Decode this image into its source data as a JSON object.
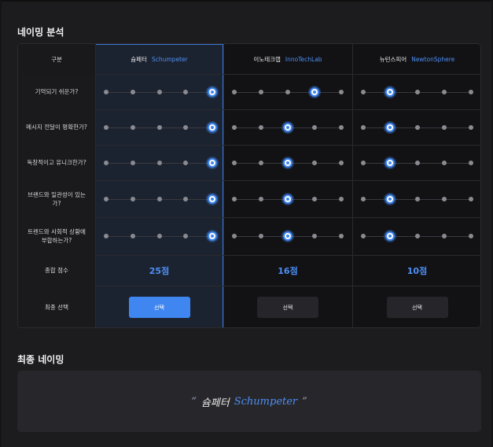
{
  "sections": {
    "analysis_title": "네이밍 분석",
    "final_title": "최종 네이밍"
  },
  "table": {
    "header_label": "구분",
    "candidates": [
      {
        "ko": "슘페터",
        "en": "Schumpeter",
        "score": "25점",
        "select_label": "선택",
        "selected": true
      },
      {
        "ko": "이노테크랩",
        "en": "InnoTechLab",
        "score": "16점",
        "select_label": "선택",
        "selected": false
      },
      {
        "ko": "뉴턴스피어",
        "en": "NewtonSphere",
        "score": "10점",
        "select_label": "선택",
        "selected": false
      }
    ],
    "criteria": [
      {
        "label": "기억되기 쉬운가?",
        "ratings": [
          5,
          4,
          2
        ]
      },
      {
        "label": "메시지 전달이 명확한가?",
        "ratings": [
          5,
          3,
          2
        ]
      },
      {
        "label": "독창적이고 유니크한가?",
        "ratings": [
          5,
          3,
          2
        ]
      },
      {
        "label": "브랜드와 일관성이 있는가?",
        "ratings": [
          5,
          3,
          2
        ]
      },
      {
        "label": "트렌드와 사회적 상황에 부합하는가?",
        "ratings": [
          5,
          3,
          2
        ]
      }
    ],
    "score_label": "종합 점수",
    "final_label": "최종 선택",
    "scale_max": 5
  },
  "final_naming": {
    "open_quote": "“",
    "ko": "슘페터",
    "en": "Schumpeter",
    "close_quote": "”"
  },
  "colors": {
    "accent": "#3f86f0",
    "accent_text": "#4d8ff5",
    "background": "#1c1c1e",
    "panel": "#27272b"
  }
}
